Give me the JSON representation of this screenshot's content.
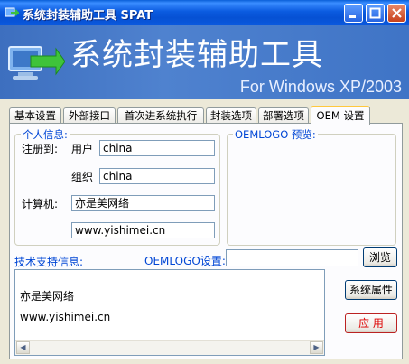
{
  "window": {
    "title": "系统封装辅助工具  SPAT"
  },
  "banner": {
    "title": "系统封装辅助工具",
    "subtitle": "For Windows XP/2003"
  },
  "tabs": [
    {
      "label": "基本设置",
      "active": false
    },
    {
      "label": "外部接口",
      "active": false
    },
    {
      "label": "首次进系统执行",
      "active": false
    },
    {
      "label": "封装选项",
      "active": false
    },
    {
      "label": "部署选项",
      "active": false
    },
    {
      "label": "OEM 设置",
      "active": true
    }
  ],
  "personal": {
    "legend": "个人信息:",
    "registered_label": "注册到:",
    "user_label": "用户",
    "user_value": "china",
    "org_label": "组织",
    "org_value": "china",
    "computer_label": "计算机:",
    "computer_value": "亦是美网络",
    "url_value": "www.yishimei.cn"
  },
  "preview": {
    "legend": "OEMLOGO 预览:"
  },
  "support": {
    "label": "技术支持信息:",
    "lines": [
      "亦是美网络",
      "www.yishimei.cn"
    ]
  },
  "oemlogo": {
    "label": "OEMLOGO设置:",
    "value": "",
    "browse_label": "浏览"
  },
  "buttons": {
    "sys_props": "系统属性",
    "apply": "应 用"
  },
  "colors": {
    "accent_blue": "#0046d5",
    "apply_red": "#dd0000"
  }
}
